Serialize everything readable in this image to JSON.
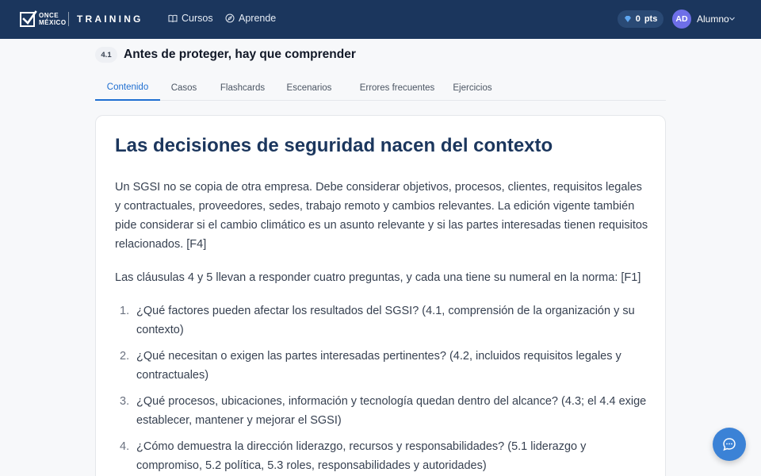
{
  "header": {
    "logo_line1": "ONCE",
    "logo_line2": "MÉXICO",
    "brand": "TRAINING",
    "nav": [
      {
        "label": "Cursos",
        "icon": "book-open-icon"
      },
      {
        "label": "Aprende",
        "icon": "compass-icon"
      }
    ],
    "points_value": "0",
    "points_unit": "pts",
    "user_initials": "AD",
    "user_name": "Alumno"
  },
  "lesson": {
    "number": "4.1",
    "title": "Antes de proteger, hay que comprender"
  },
  "tabs": [
    {
      "label": "Contenido",
      "active": true
    },
    {
      "label": "Casos",
      "active": false
    },
    {
      "label": "Flashcards",
      "active": false
    },
    {
      "label": "Escenarios",
      "active": false
    },
    {
      "label": "Errores frecuentes",
      "active": false
    },
    {
      "label": "Ejercicios",
      "active": false
    }
  ],
  "content": {
    "title": "Las decisiones de seguridad nacen del contexto",
    "paragraph1": "Un SGSI no se copia de otra empresa. Debe considerar objetivos, procesos, clientes, requisitos legales y contractuales, proveedores, sedes, trabajo remoto y cambios relevantes. La edición vigente también pide considerar si el cambio climático es un asunto relevante y si las partes interesadas tienen requisitos relacionados. [F4]",
    "paragraph2": "Las cláusulas 4 y 5 llevan a responder cuatro preguntas, y cada una tiene su numeral en la norma: [F1]",
    "list": [
      {
        "num": "1.",
        "text": "¿Qué factores pueden afectar los resultados del SGSI? (4.1, comprensión de la organización y su contexto)"
      },
      {
        "num": "2.",
        "text": "¿Qué necesitan o exigen las partes interesadas pertinentes? (4.2, incluidos requisitos legales y contractuales)"
      },
      {
        "num": "3.",
        "text": "¿Qué procesos, ubicaciones, información y tecnología quedan dentro del alcance? (4.3; el 4.4 exige establecer, mantener y mejorar el SGSI)"
      },
      {
        "num": "4.",
        "text": "¿Cómo demuestra la dirección liderazgo, recursos y responsabilidades? (5.1 liderazgo y compromiso, 5.2 política, 5.3 roles, responsabilidades y autoridades)"
      }
    ]
  },
  "colors": {
    "header_bg": "#1b365d",
    "accent": "#1f6fd1",
    "title_color": "#1b365d",
    "avatar_bg": "#6e6fe8",
    "fab_bg": "#3b82d6"
  }
}
